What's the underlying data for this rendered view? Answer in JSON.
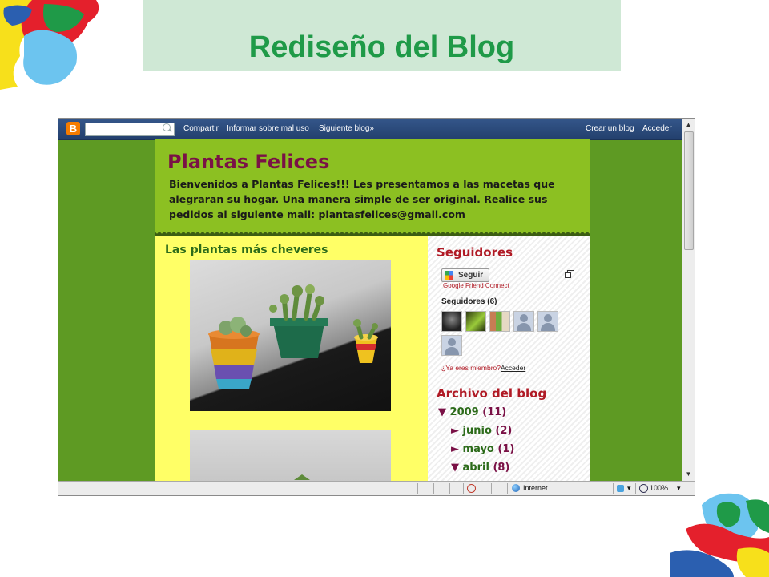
{
  "slide": {
    "title": "Rediseño del Blog"
  },
  "navbar": {
    "links": [
      "Compartir",
      "Informar sobre mal uso",
      "Siguiente blog»"
    ],
    "right_links": [
      "Crear un blog",
      "Acceder"
    ]
  },
  "blog": {
    "title": "Plantas Felices",
    "description": "Bienvenidos a Plantas Felices!!! Les presentamos a las macetas que alegraran su hogar. Una manera simple de ser original. Realice sus pedidos al siguiente mail: plantasfelices@gmail.com",
    "post_title": "Las plantas más cheveres"
  },
  "sidebar": {
    "followers_heading": "Seguidores",
    "follow_button": "Seguir",
    "gfc_text": "Google Friend Connect",
    "followers_count_label": "Seguidores (6)",
    "member_question": "¿Ya eres miembro?",
    "member_link": "Acceder",
    "archive_heading": "Archivo del blog",
    "archive": [
      {
        "arrow": "▼",
        "label": "2009",
        "count": "(11)"
      },
      {
        "arrow": "►",
        "label": "junio",
        "count": "(2)"
      },
      {
        "arrow": "►",
        "label": "mayo",
        "count": "(1)"
      },
      {
        "arrow": "▼",
        "label": "abril",
        "count": "(8)"
      }
    ]
  },
  "statusbar": {
    "zone": "Internet",
    "zoom": "100%"
  },
  "colors": {
    "title_green": "#1f9a48",
    "title_box": "#cfe8d5",
    "page_green": "#5e9a23",
    "header_green": "#8cc022",
    "post_yellow": "#ffff66",
    "blog_title": "#7a1146",
    "sidebar_heading": "#b01a25",
    "navbar": "#2b4a7a"
  }
}
